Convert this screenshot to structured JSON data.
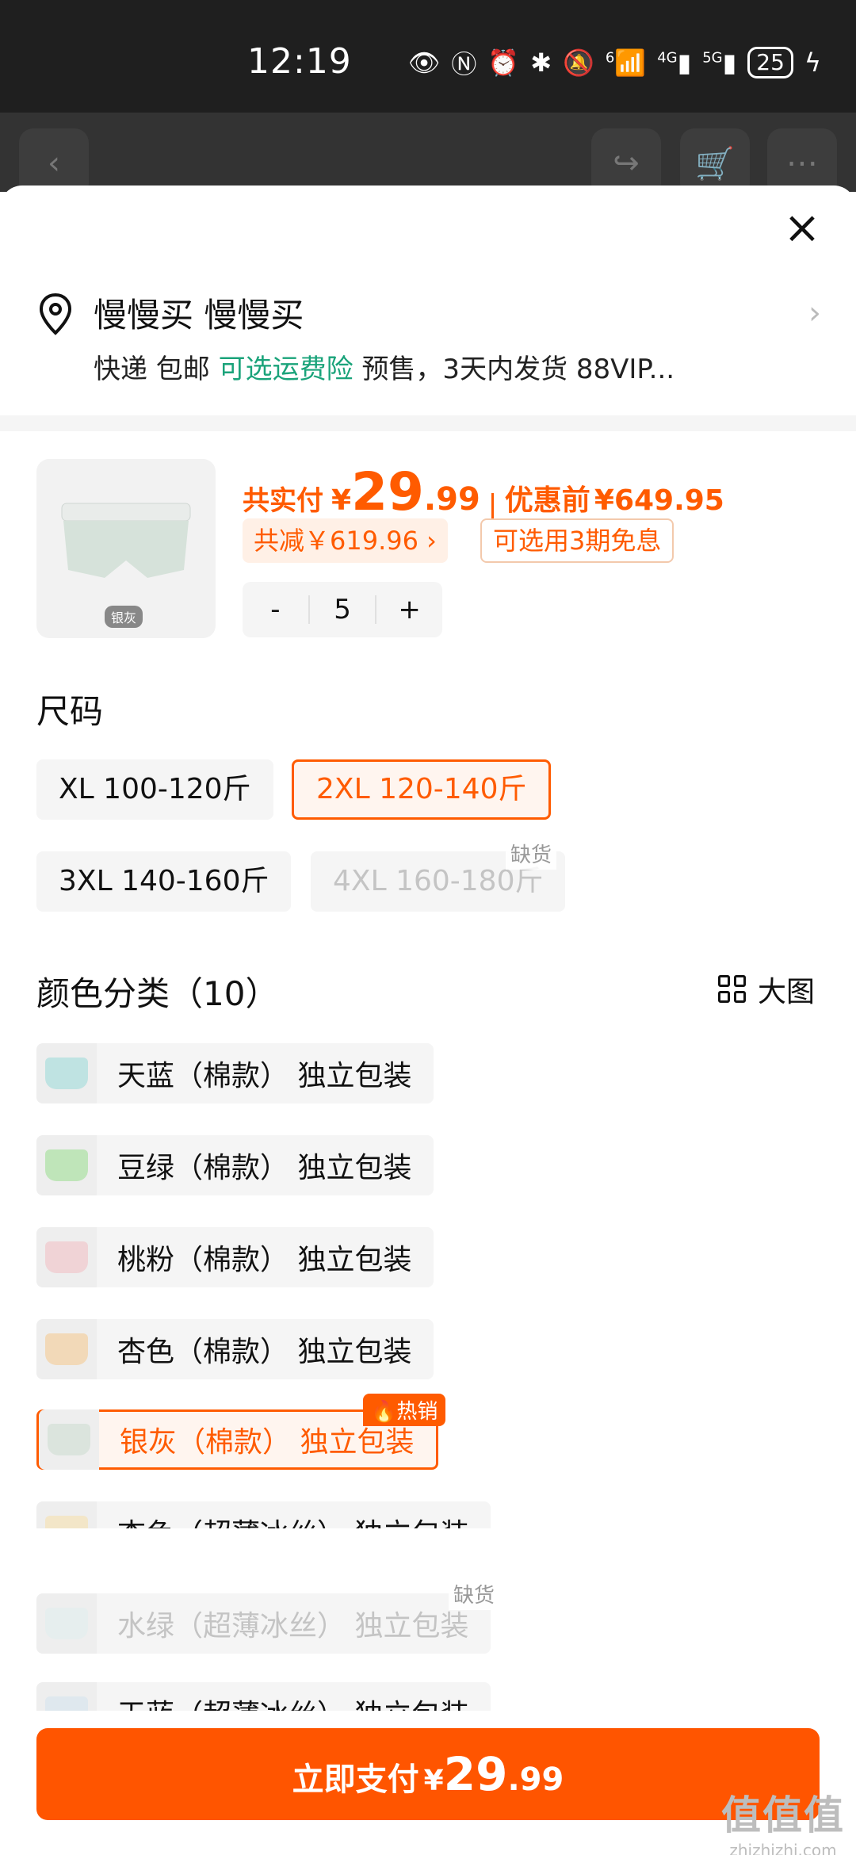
{
  "status_bar": {
    "time": "12:19",
    "battery": "25",
    "network_4g": "4G",
    "network_5g": "5G",
    "wifi": "6"
  },
  "address": {
    "name": "慢慢买 慢慢买",
    "delivery": "快递 包邮",
    "insurance_link": "可选运费险",
    "presale": "预售，3天内发货 88VIP..."
  },
  "product": {
    "image_tag": "银灰",
    "price_label": "共实付",
    "currency": "¥",
    "price_int": "29",
    "price_dec": ".99",
    "original_label": "优惠前",
    "original_price": "¥649.95",
    "discount": "共减￥619.96 ›",
    "installment": "可选用3期免息",
    "qty_minus": "-",
    "qty": "5",
    "qty_plus": "+"
  },
  "size": {
    "title": "尺码",
    "options": [
      {
        "label": "XL 100-120斤",
        "state": "normal"
      },
      {
        "label": "2XL 120-140斤",
        "state": "selected"
      },
      {
        "label": "3XL 140-160斤",
        "state": "normal"
      },
      {
        "label": "4XL 160-180斤",
        "state": "disabled",
        "badge": "缺货"
      }
    ]
  },
  "color": {
    "title": "颜色分类（10）",
    "big_image_label": "大图",
    "options": [
      {
        "label": "天蓝（棉款） 独立包装",
        "state": "normal",
        "swatch": "#bfe3e2"
      },
      {
        "label": "豆绿（棉款） 独立包装",
        "state": "normal",
        "swatch": "#bfe5b9"
      },
      {
        "label": "桃粉（棉款） 独立包装",
        "state": "normal",
        "swatch": "#f0d3d6"
      },
      {
        "label": "杏色（棉款） 独立包装",
        "state": "normal",
        "swatch": "#f2d9b8"
      },
      {
        "label": "银灰（棉款） 独立包装",
        "state": "selected",
        "swatch": "#dbe4dd",
        "badge": "热销"
      },
      {
        "label": "杏色（超薄冰丝） 独立包装",
        "state": "normal",
        "swatch": "#f3e6c8"
      },
      {
        "label": "水绿（超薄冰丝） 独立包装",
        "state": "disabled",
        "swatch": "#e6eeee",
        "badge": "缺货"
      },
      {
        "label": "天蓝（超薄冰丝） 独立包装",
        "state": "normal",
        "swatch": "#dfe8ee"
      }
    ]
  },
  "pay": {
    "label": "立即支付",
    "currency": "¥",
    "price_int": "29",
    "price_dec": ".99"
  },
  "watermark": {
    "line1": "值值值",
    "line2": "zhizhizhi.com"
  },
  "colors": {
    "accent": "#ff5b00",
    "link": "#1aa37a"
  }
}
